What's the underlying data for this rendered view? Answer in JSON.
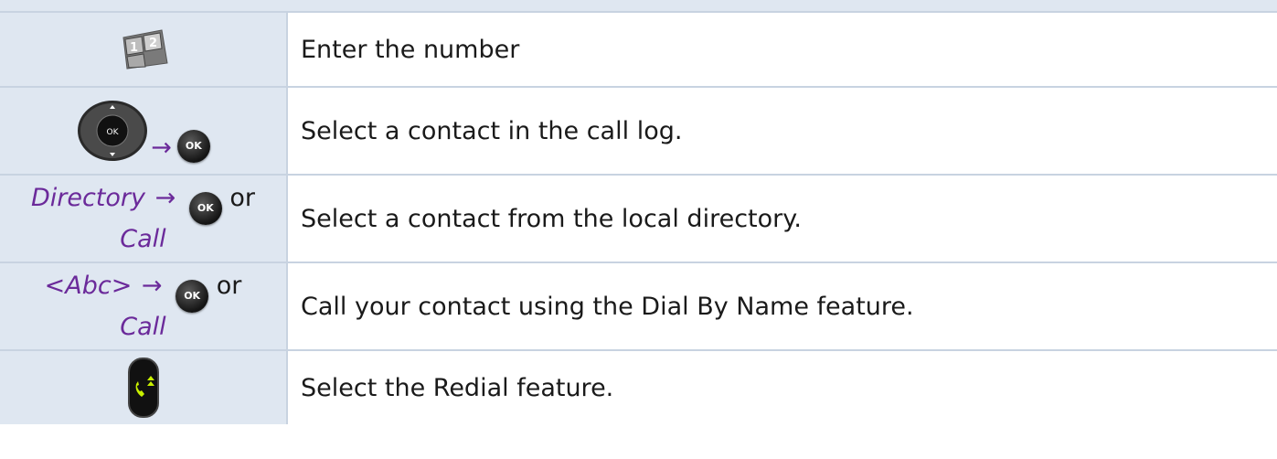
{
  "rows": [
    {
      "icon": "numeric-keypad-icon",
      "description": "Enter the number"
    },
    {
      "icon": "navigator-ok-icon",
      "ok_label": "OK",
      "arrow": "→",
      "description": "Select a contact in the call log."
    },
    {
      "key_label": "Directory",
      "arrow": "→",
      "ok_label": "OK",
      "or_text": "or",
      "alt_key_label": "Call",
      "description": "Select a contact from the local directory."
    },
    {
      "key_label": "<Abc>",
      "arrow": "→",
      "ok_label": "OK",
      "or_text": "or",
      "alt_key_label": "Call",
      "description": "Call your contact using the Dial By Name feature."
    },
    {
      "icon": "redial-key-icon",
      "description": "Select the Redial feature."
    }
  ],
  "keypad_digits": [
    "1",
    "2"
  ],
  "colors": {
    "left_cell_bg": "#dfe7f1",
    "border": "#c8d3e1",
    "key_text": "#6b2a9a",
    "redial_accent": "#c8f000"
  }
}
